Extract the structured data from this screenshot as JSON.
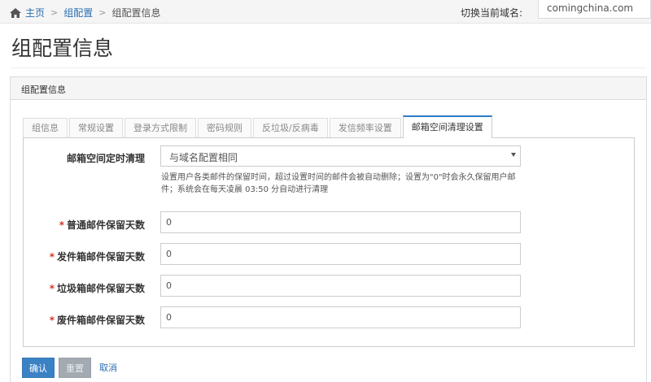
{
  "breadcrumb": {
    "home": "主页",
    "level2": "组配置",
    "current": "组配置信息"
  },
  "domain_switch": {
    "label": "切换当前域名:",
    "value": "comingchina.com"
  },
  "page_title": "组配置信息",
  "panel_title": "组配置信息",
  "tabs": [
    "组信息",
    "常规设置",
    "登录方式限制",
    "密码规则",
    "反垃圾/反病毒",
    "发信频率设置",
    "邮箱空间清理设置"
  ],
  "active_tab": "邮箱空间清理设置",
  "form": {
    "schedule": {
      "label": "邮箱空间定时清理",
      "value": "与域名配置相同",
      "help": "设置用户各类邮件的保留时间，超过设置时间的邮件会被自动删除；设置为\"0\"时会永久保留用户邮件；系统会在每天凌晨 03:50 分自动进行清理"
    },
    "fields": [
      {
        "label": "普通邮件保留天数",
        "value": "0",
        "required": "*"
      },
      {
        "label": "发件箱邮件保留天数",
        "value": "0",
        "required": "*"
      },
      {
        "label": "垃圾箱邮件保留天数",
        "value": "0",
        "required": "*"
      },
      {
        "label": "废件箱邮件保留天数",
        "value": "0",
        "required": "*"
      }
    ]
  },
  "buttons": {
    "confirm": "确认",
    "reset": "重置",
    "cancel": "取消"
  },
  "colors": {
    "accent": "#2b7bc4",
    "required": "#d9342b",
    "link": "#2a6fb0"
  }
}
